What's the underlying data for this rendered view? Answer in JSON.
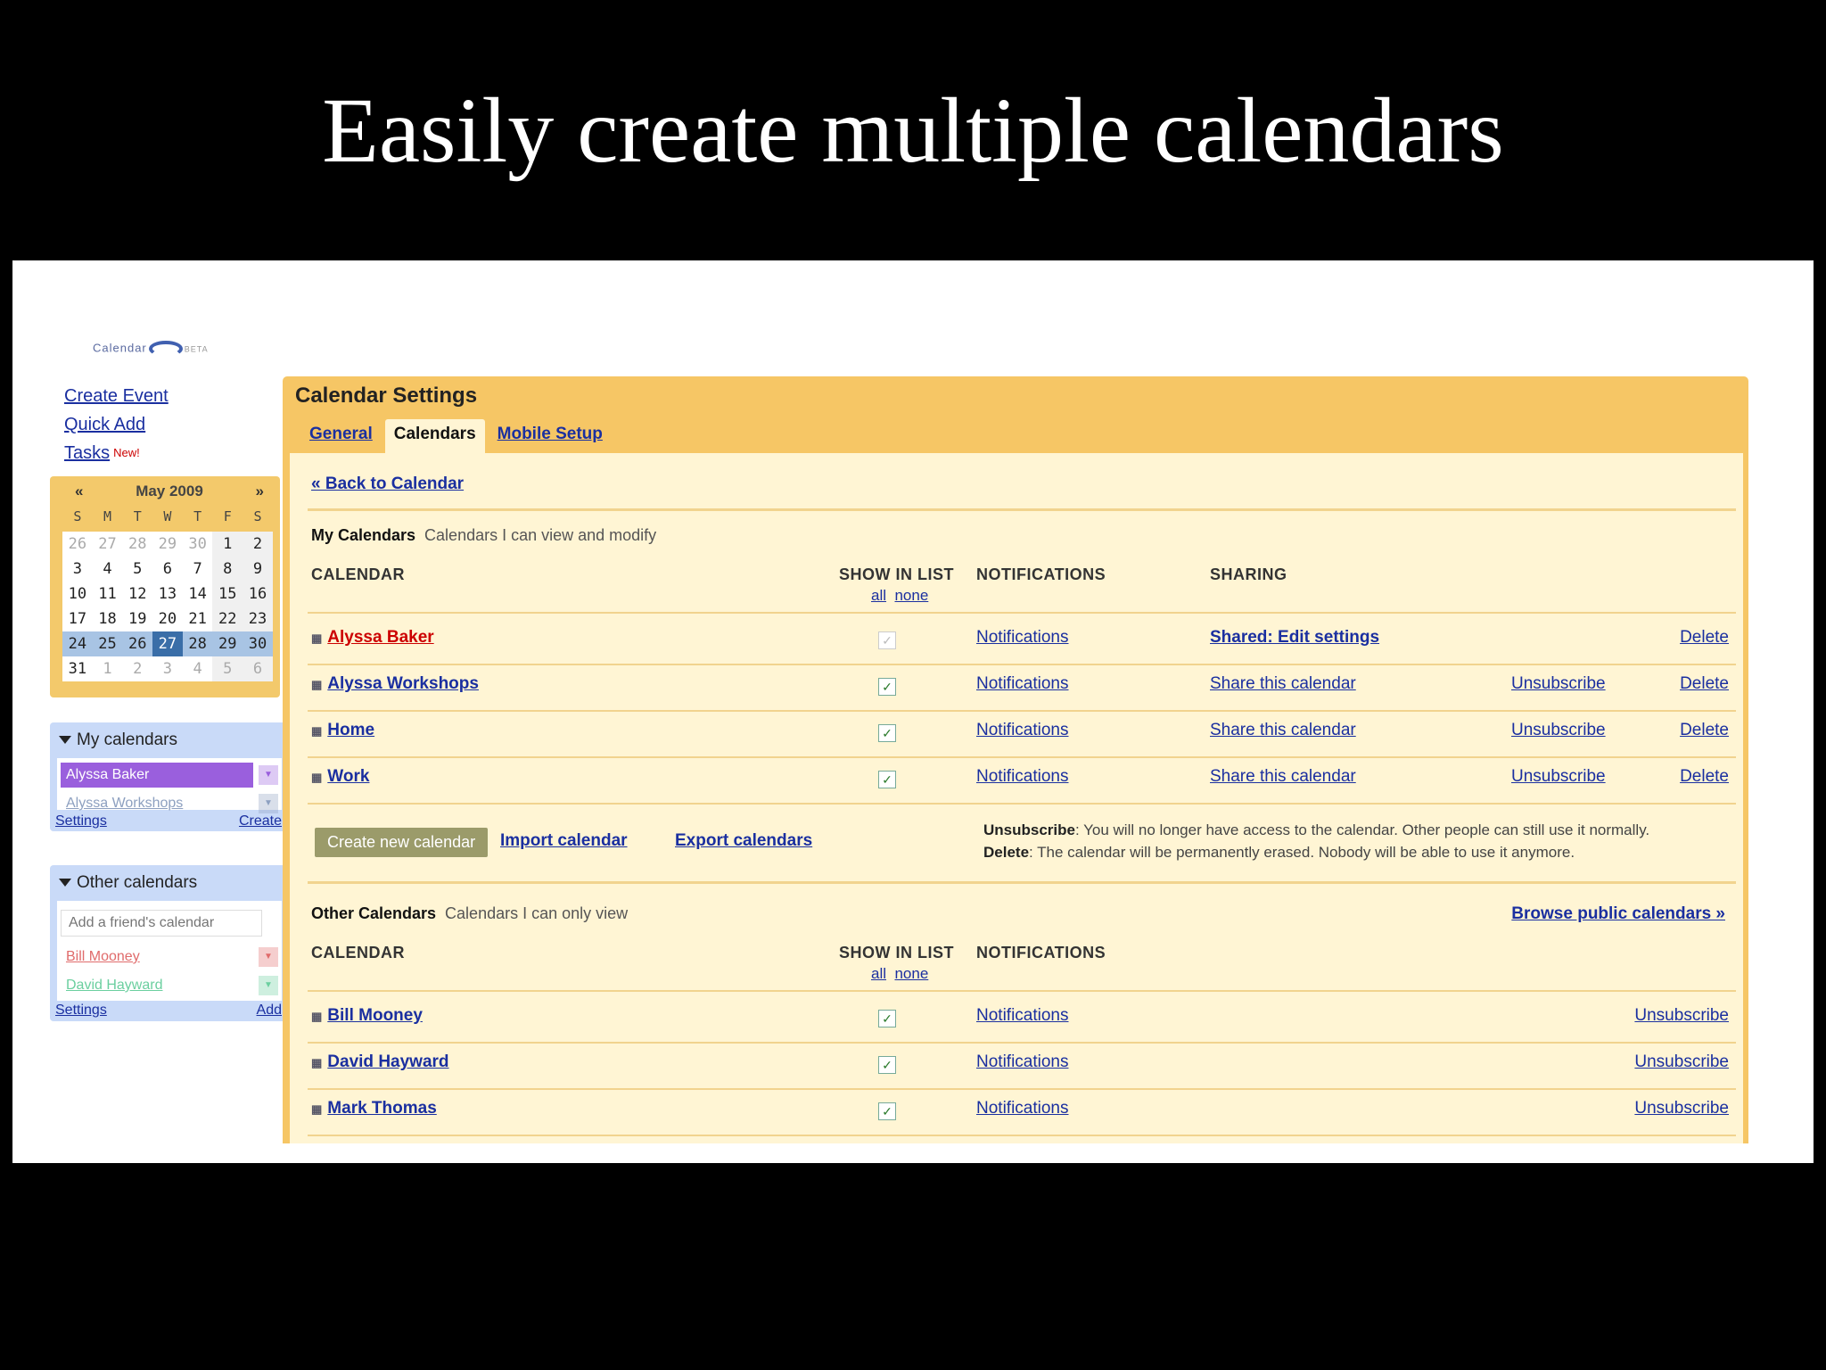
{
  "slide": {
    "title": "Easily create multiple calendars"
  },
  "app": {
    "logo_text": "Calendar",
    "logo_beta": "BETA"
  },
  "left_links": {
    "create_event": "Create Event",
    "quick_add": "Quick Add",
    "tasks": "Tasks",
    "tasks_badge": "New!"
  },
  "mini_calendar": {
    "prev": "«",
    "next": "»",
    "month_label": "May 2009",
    "dow": [
      "S",
      "M",
      "T",
      "W",
      "T",
      "F",
      "S"
    ],
    "weeks": [
      [
        "26",
        "27",
        "28",
        "29",
        "30",
        "1",
        "2"
      ],
      [
        "3",
        "4",
        "5",
        "6",
        "7",
        "8",
        "9"
      ],
      [
        "10",
        "11",
        "12",
        "13",
        "14",
        "15",
        "16"
      ],
      [
        "17",
        "18",
        "19",
        "20",
        "21",
        "22",
        "23"
      ],
      [
        "24",
        "25",
        "26",
        "27",
        "28",
        "29",
        "30"
      ],
      [
        "31",
        "1",
        "2",
        "3",
        "4",
        "5",
        "6"
      ]
    ],
    "today": "27"
  },
  "my_calendars_box": {
    "title": "My calendars",
    "items": [
      {
        "label": "Alyssa Baker",
        "color": "#9a5fdd"
      },
      {
        "label": "Alyssa Workshops",
        "color": "#8da0c0"
      }
    ],
    "settings": "Settings",
    "create": "Create"
  },
  "other_calendars_box": {
    "title": "Other calendars",
    "add_placeholder": "Add a friend's calendar",
    "items": [
      {
        "label": "Bill Mooney",
        "color": "#e06b6b"
      },
      {
        "label": "David Hayward",
        "color": "#6bcf9f"
      }
    ],
    "settings": "Settings",
    "add": "Add"
  },
  "settings": {
    "title": "Calendar Settings",
    "tabs": [
      "General",
      "Calendars",
      "Mobile Setup"
    ],
    "back": "« Back to Calendar",
    "my_section": {
      "title": "My Calendars",
      "subtitle": "Calendars I can view and modify"
    },
    "columns": {
      "calendar": "CALENDAR",
      "show": "SHOW IN LIST",
      "all": "all",
      "none": "none",
      "notifications": "NOTIFICATIONS",
      "sharing": "SHARING"
    },
    "my_rows": [
      {
        "name": "Alyssa Baker",
        "notifications": "Notifications",
        "sharing": "Shared: Edit settings",
        "unsubscribe": "",
        "delete": "Delete"
      },
      {
        "name": "Alyssa Workshops",
        "notifications": "Notifications",
        "sharing": "Share this calendar",
        "unsubscribe": "Unsubscribe",
        "delete": "Delete"
      },
      {
        "name": "Home",
        "notifications": "Notifications",
        "sharing": "Share this calendar",
        "unsubscribe": "Unsubscribe",
        "delete": "Delete"
      },
      {
        "name": "Work",
        "notifications": "Notifications",
        "sharing": "Share this calendar",
        "unsubscribe": "Unsubscribe",
        "delete": "Delete"
      }
    ],
    "actions": {
      "create": "Create new calendar",
      "import": "Import calendar",
      "export": "Export calendars"
    },
    "note": {
      "unsub_label": "Unsubscribe",
      "unsub_text": ": You will no longer have access to the calendar. Other people can still use it normally.",
      "delete_label": "Delete",
      "delete_text": ": The calendar will be permanently erased. Nobody will be able to use it anymore."
    },
    "other_section": {
      "title": "Other Calendars",
      "subtitle": "Calendars I can only view",
      "browse": "Browse public calendars »"
    },
    "other_rows": [
      {
        "name": "Bill Mooney",
        "notifications": "Notifications",
        "unsubscribe": "Unsubscribe"
      },
      {
        "name": "David Hayward",
        "notifications": "Notifications",
        "unsubscribe": "Unsubscribe"
      },
      {
        "name": "Mark Thomas",
        "notifications": "Notifications",
        "unsubscribe": "Unsubscribe"
      }
    ]
  }
}
